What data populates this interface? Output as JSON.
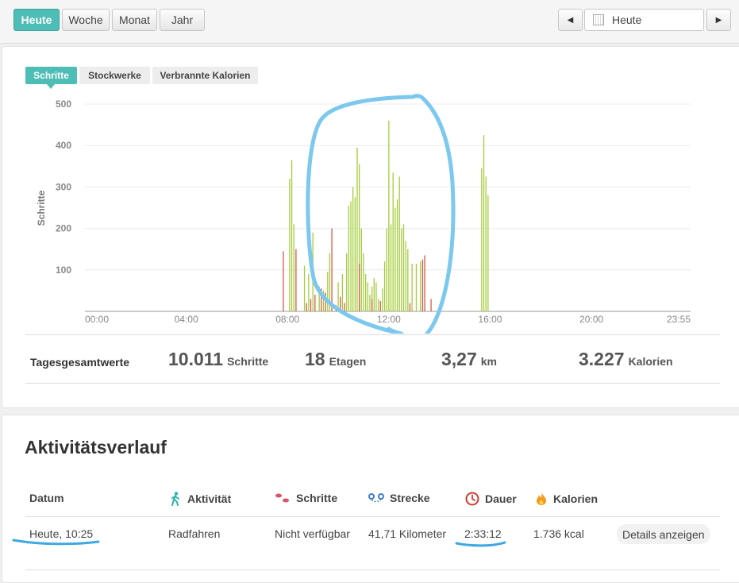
{
  "period_tabs": [
    "Heute",
    "Woche",
    "Monat",
    "Jahr"
  ],
  "active_period": "Heute",
  "date_picker": {
    "value": "Heute",
    "prev_icon": "triangle-left-icon",
    "next_icon": "triangle-right-icon",
    "calendar_icon": "calendar-icon"
  },
  "metric_tabs": [
    "Schritte",
    "Stockwerke",
    "Verbrannte Kalorien"
  ],
  "active_metric": "Schritte",
  "chart_data": {
    "type": "bar",
    "ylabel": "Schritte",
    "xlabel": "",
    "ylim": [
      0,
      500
    ],
    "y_ticks": [
      100,
      200,
      300,
      400,
      500
    ],
    "x_range_minutes": [
      0,
      1435
    ],
    "x_tick_labels": [
      "00:00",
      "04:00",
      "08:00",
      "12:00",
      "16:00",
      "20:00",
      "23:55"
    ],
    "x_tick_minutes": [
      0,
      240,
      480,
      720,
      960,
      1200,
      1435
    ],
    "grid": true,
    "series": [
      {
        "color": "#a4cc3a",
        "time_minutes": [
          485,
          490,
          495,
          520,
          530,
          540,
          555,
          565,
          575,
          580,
          600,
          610,
          620,
          625,
          630,
          635,
          640,
          645,
          650,
          655,
          660,
          665,
          670,
          675,
          680,
          685,
          690,
          695,
          705,
          710,
          715,
          720,
          725,
          730,
          735,
          740,
          745,
          750,
          755,
          760,
          765,
          775,
          785,
          795,
          940,
          945,
          950,
          955
        ],
        "values": [
          320,
          365,
          210,
          110,
          90,
          190,
          60,
          50,
          95,
          140,
          70,
          90,
          140,
          255,
          265,
          300,
          275,
          395,
          355,
          200,
          140,
          90,
          70,
          40,
          60,
          80,
          70,
          30,
          55,
          120,
          200,
          460,
          210,
          335,
          250,
          270,
          325,
          200,
          210,
          170,
          150,
          115,
          115,
          120,
          345,
          425,
          325,
          280
        ]
      },
      {
        "color": "#d15a45",
        "time_minutes": [
          470,
          500,
          525,
          535,
          545,
          560,
          570,
          585,
          595,
          605,
          615,
          650,
          680,
          700,
          770,
          800,
          805,
          820
        ],
        "values": [
          145,
          150,
          20,
          30,
          40,
          55,
          45,
          200,
          15,
          35,
          20,
          115,
          30,
          25,
          20,
          125,
          135,
          30
        ]
      }
    ]
  },
  "daily_totals": {
    "label": "Tagesgesamtwerte",
    "steps": {
      "value": "10.011",
      "unit": "Schritte"
    },
    "floors": {
      "value": "18",
      "unit": "Etagen"
    },
    "distance": {
      "value": "3,27",
      "unit": "km"
    },
    "calories": {
      "value": "3.227",
      "unit": "Kalorien"
    }
  },
  "history": {
    "title": "Aktivitätsverlauf",
    "columns": [
      {
        "label": "Datum",
        "icon": ""
      },
      {
        "label": "Aktivität",
        "icon": "walking-person-icon",
        "color": "#2db3ac"
      },
      {
        "label": "Schritte",
        "icon": "footprints-icon",
        "color": "#d9546a"
      },
      {
        "label": "Strecke",
        "icon": "route-pins-icon",
        "color": "#3f7ecb"
      },
      {
        "label": "Dauer",
        "icon": "clock-icon",
        "color": "#d13b2e"
      },
      {
        "label": "Kalorien",
        "icon": "flame-icon",
        "color": "#f39a1f"
      }
    ],
    "rows": [
      {
        "datum": "Heute, 10:25",
        "aktivitaet": "Radfahren",
        "schritte": "Nicht verfügbar",
        "strecke": "41,71 Kilometer",
        "dauer": "2:33:12",
        "kalorien": "1.736 kcal",
        "details_label": "Details anzeigen"
      }
    ]
  }
}
